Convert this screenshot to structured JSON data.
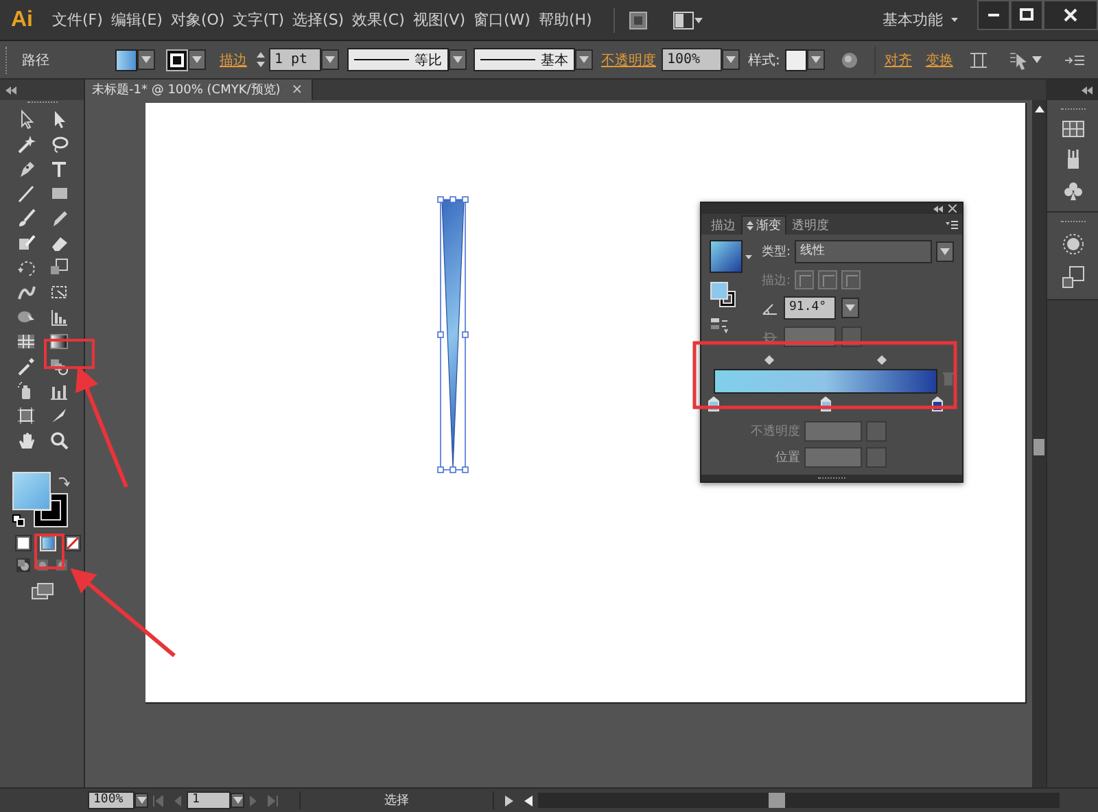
{
  "menu_bar": {
    "logo": "Ai",
    "items": [
      "文件(F)",
      "编辑(E)",
      "对象(O)",
      "文字(T)",
      "选择(S)",
      "效果(C)",
      "视图(V)",
      "窗口(W)",
      "帮助(H)"
    ],
    "workspace": "基本功能"
  },
  "control_bar": {
    "object_label": "路径",
    "stroke_label": "描边",
    "stroke_weight": "1 pt",
    "profile": "等比",
    "brush": "基本",
    "opacity_label": "不透明度",
    "opacity": "100%",
    "style_label": "样式:",
    "align": "对齐",
    "transform": "变换"
  },
  "document_tab": {
    "title": "未标题-1* @ 100% (CMYK/预览)",
    "close": "×"
  },
  "toolbox": {
    "fill_modes": [
      {
        "kind": "color",
        "selected": false
      },
      {
        "kind": "gradient",
        "selected": true
      },
      {
        "kind": "none",
        "selected": false
      }
    ]
  },
  "gradient_panel": {
    "tabs": [
      {
        "label": "描边",
        "selected": false
      },
      {
        "label": "渐变",
        "selected": true
      },
      {
        "label": "透明度",
        "selected": false
      }
    ],
    "type_label": "类型:",
    "type": "线性",
    "stroke_label": "描边:",
    "angle": "91.4°",
    "stops": [
      {
        "color": "#7fd0ea"
      },
      {
        "color": "#8ec3e6"
      },
      {
        "color": "#1e3f9c"
      }
    ],
    "opacity_label": "不透明度",
    "location_label": "位置"
  },
  "status_bar": {
    "zoom": "100%",
    "page": "1",
    "tool": "选择"
  }
}
